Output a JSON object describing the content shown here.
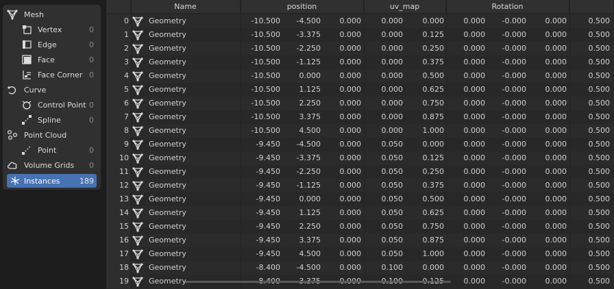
{
  "panel": {
    "mesh": {
      "label": "Mesh"
    },
    "vertex": {
      "label": "Vertex",
      "count": "0"
    },
    "edge": {
      "label": "Edge",
      "count": "0"
    },
    "face": {
      "label": "Face",
      "count": "0"
    },
    "face_corner": {
      "label": "Face Corner",
      "count": "0"
    },
    "curve": {
      "label": "Curve"
    },
    "control_point": {
      "label": "Control Point",
      "count": "0"
    },
    "spline": {
      "label": "Spline",
      "count": "0"
    },
    "point_cloud": {
      "label": "Point Cloud"
    },
    "point": {
      "label": "Point",
      "count": "0"
    },
    "volume_grids": {
      "label": "Volume Grids",
      "count": "0"
    },
    "instances": {
      "label": "Instances",
      "count": "189"
    }
  },
  "columns": {
    "name": "Name",
    "position": "position",
    "uv_map": "uv_map",
    "rotation": "Rotation"
  },
  "colors": {
    "accent": "#4772b3",
    "background": "#1d1d1d",
    "panel": "#303030"
  },
  "rows": [
    {
      "index": "0",
      "name": "Geometry",
      "pos": [
        "-10.500",
        "-4.500",
        "0.000"
      ],
      "uv": [
        "0.000",
        "0.000"
      ],
      "rot": [
        "0.000",
        "-0.000",
        "0.000"
      ],
      "scale": "0.500"
    },
    {
      "index": "1",
      "name": "Geometry",
      "pos": [
        "-10.500",
        "-3.375",
        "0.000"
      ],
      "uv": [
        "0.000",
        "0.125"
      ],
      "rot": [
        "0.000",
        "-0.000",
        "0.000"
      ],
      "scale": "0.500"
    },
    {
      "index": "2",
      "name": "Geometry",
      "pos": [
        "-10.500",
        "-2.250",
        "0.000"
      ],
      "uv": [
        "0.000",
        "0.250"
      ],
      "rot": [
        "0.000",
        "-0.000",
        "0.000"
      ],
      "scale": "0.500"
    },
    {
      "index": "3",
      "name": "Geometry",
      "pos": [
        "-10.500",
        "-1.125",
        "0.000"
      ],
      "uv": [
        "0.000",
        "0.375"
      ],
      "rot": [
        "0.000",
        "-0.000",
        "0.000"
      ],
      "scale": "0.500"
    },
    {
      "index": "4",
      "name": "Geometry",
      "pos": [
        "-10.500",
        "0.000",
        "0.000"
      ],
      "uv": [
        "0.000",
        "0.500"
      ],
      "rot": [
        "0.000",
        "-0.000",
        "0.000"
      ],
      "scale": "0.500"
    },
    {
      "index": "5",
      "name": "Geometry",
      "pos": [
        "-10.500",
        "1.125",
        "0.000"
      ],
      "uv": [
        "0.000",
        "0.625"
      ],
      "rot": [
        "0.000",
        "-0.000",
        "0.000"
      ],
      "scale": "0.500"
    },
    {
      "index": "6",
      "name": "Geometry",
      "pos": [
        "-10.500",
        "2.250",
        "0.000"
      ],
      "uv": [
        "0.000",
        "0.750"
      ],
      "rot": [
        "0.000",
        "-0.000",
        "0.000"
      ],
      "scale": "0.500"
    },
    {
      "index": "7",
      "name": "Geometry",
      "pos": [
        "-10.500",
        "3.375",
        "0.000"
      ],
      "uv": [
        "0.000",
        "0.875"
      ],
      "rot": [
        "0.000",
        "-0.000",
        "0.000"
      ],
      "scale": "0.500"
    },
    {
      "index": "8",
      "name": "Geometry",
      "pos": [
        "-10.500",
        "4.500",
        "0.000"
      ],
      "uv": [
        "0.000",
        "1.000"
      ],
      "rot": [
        "0.000",
        "-0.000",
        "0.000"
      ],
      "scale": "0.500"
    },
    {
      "index": "9",
      "name": "Geometry",
      "pos": [
        "-9.450",
        "-4.500",
        "0.000"
      ],
      "uv": [
        "0.050",
        "0.000"
      ],
      "rot": [
        "0.000",
        "-0.000",
        "0.000"
      ],
      "scale": "0.500"
    },
    {
      "index": "10",
      "name": "Geometry",
      "pos": [
        "-9.450",
        "-3.375",
        "0.000"
      ],
      "uv": [
        "0.050",
        "0.125"
      ],
      "rot": [
        "0.000",
        "-0.000",
        "0.000"
      ],
      "scale": "0.500"
    },
    {
      "index": "11",
      "name": "Geometry",
      "pos": [
        "-9.450",
        "-2.250",
        "0.000"
      ],
      "uv": [
        "0.050",
        "0.250"
      ],
      "rot": [
        "0.000",
        "-0.000",
        "0.000"
      ],
      "scale": "0.500"
    },
    {
      "index": "12",
      "name": "Geometry",
      "pos": [
        "-9.450",
        "-1.125",
        "0.000"
      ],
      "uv": [
        "0.050",
        "0.375"
      ],
      "rot": [
        "0.000",
        "-0.000",
        "0.000"
      ],
      "scale": "0.500"
    },
    {
      "index": "13",
      "name": "Geometry",
      "pos": [
        "-9.450",
        "0.000",
        "0.000"
      ],
      "uv": [
        "0.050",
        "0.500"
      ],
      "rot": [
        "0.000",
        "-0.000",
        "0.000"
      ],
      "scale": "0.500"
    },
    {
      "index": "14",
      "name": "Geometry",
      "pos": [
        "-9.450",
        "1.125",
        "0.000"
      ],
      "uv": [
        "0.050",
        "0.625"
      ],
      "rot": [
        "0.000",
        "-0.000",
        "0.000"
      ],
      "scale": "0.500"
    },
    {
      "index": "15",
      "name": "Geometry",
      "pos": [
        "-9.450",
        "2.250",
        "0.000"
      ],
      "uv": [
        "0.050",
        "0.750"
      ],
      "rot": [
        "0.000",
        "-0.000",
        "0.000"
      ],
      "scale": "0.500"
    },
    {
      "index": "16",
      "name": "Geometry",
      "pos": [
        "-9.450",
        "3.375",
        "0.000"
      ],
      "uv": [
        "0.050",
        "0.875"
      ],
      "rot": [
        "0.000",
        "-0.000",
        "0.000"
      ],
      "scale": "0.500"
    },
    {
      "index": "17",
      "name": "Geometry",
      "pos": [
        "-9.450",
        "4.500",
        "0.000"
      ],
      "uv": [
        "0.050",
        "1.000"
      ],
      "rot": [
        "0.000",
        "-0.000",
        "0.000"
      ],
      "scale": "0.500"
    },
    {
      "index": "18",
      "name": "Geometry",
      "pos": [
        "-8.400",
        "-4.500",
        "0.000"
      ],
      "uv": [
        "0.100",
        "0.000"
      ],
      "rot": [
        "0.000",
        "-0.000",
        "0.000"
      ],
      "scale": "0.500"
    },
    {
      "index": "19",
      "name": "Geometry",
      "pos": [
        "-8.400",
        "-3.375",
        "0.000"
      ],
      "uv": [
        "0.100",
        "0.125"
      ],
      "rot": [
        "0.000",
        "-0.000",
        "0.000"
      ],
      "scale": "0.500"
    }
  ]
}
